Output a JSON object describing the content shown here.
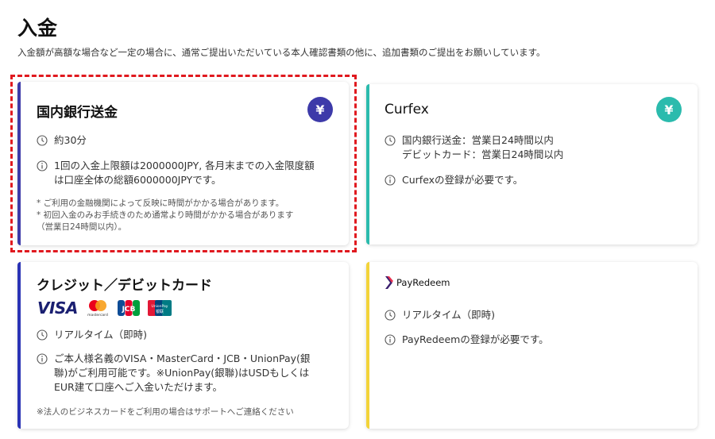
{
  "page": {
    "title": "入金",
    "description": "入金額が高額な場合など一定の場合に、通常ご提出いただいている本人確認書類の他に、追加書類のご提出をお願いしています。"
  },
  "colors": {
    "domestic_accent": "#3d3aa9",
    "curfex_accent": "#2bbbad",
    "card_accent": "#2a33b5",
    "payredeem_accent": "#f3d43a",
    "highlight": "#e0191f"
  },
  "cards": {
    "domestic": {
      "title": "国内銀行送金",
      "badge": "¥",
      "badge_icon": "yen-icon",
      "time": "約30分",
      "info_line1": "1回の入金上限額は2000000JPY, 各月末までの入金限度額",
      "info_line2": "は口座全体の総額6000000JPYです。",
      "note1": "* ご利用の金融機関によって反映に時間がかかる場合があります。",
      "note2": "* 初回入金のみお手続きのため通常より時間がかかる場合があります",
      "note3": "（営業日24時間以内）。"
    },
    "curfex": {
      "title": "Curfex",
      "badge": "¥",
      "badge_icon": "yen-icon",
      "time_line1": "国内銀行送金：営業日24時間以内",
      "time_line2": "デビットカード：営業日24時間以内",
      "info": "Curfexの登録が必要です。"
    },
    "credit": {
      "title": "クレジット／デビットカード",
      "logo_visa": "VISA",
      "logo_mastercard_caption": "mastercard",
      "logo_jcb": "JCB",
      "logo_unionpay": "UnionPay",
      "logo_unionpay_sub": "银联",
      "time": "リアルタイム（即時)",
      "info_line1": "ご本人様名義のVISA・MasterCard・JCB・UnionPay(銀",
      "info_line2": "聯)がご利用可能です。※UnionPay(銀聯)はUSDもしくは",
      "info_line3": "EUR建て口座へご入金いただけます。",
      "note": "※法人のビジネスカードをご利用の場合はサポートへご連絡ください"
    },
    "payredeem": {
      "logo_text": "PayRedeem",
      "time": "リアルタイム（即時)",
      "info": "PayRedeemの登録が必要です。"
    }
  }
}
